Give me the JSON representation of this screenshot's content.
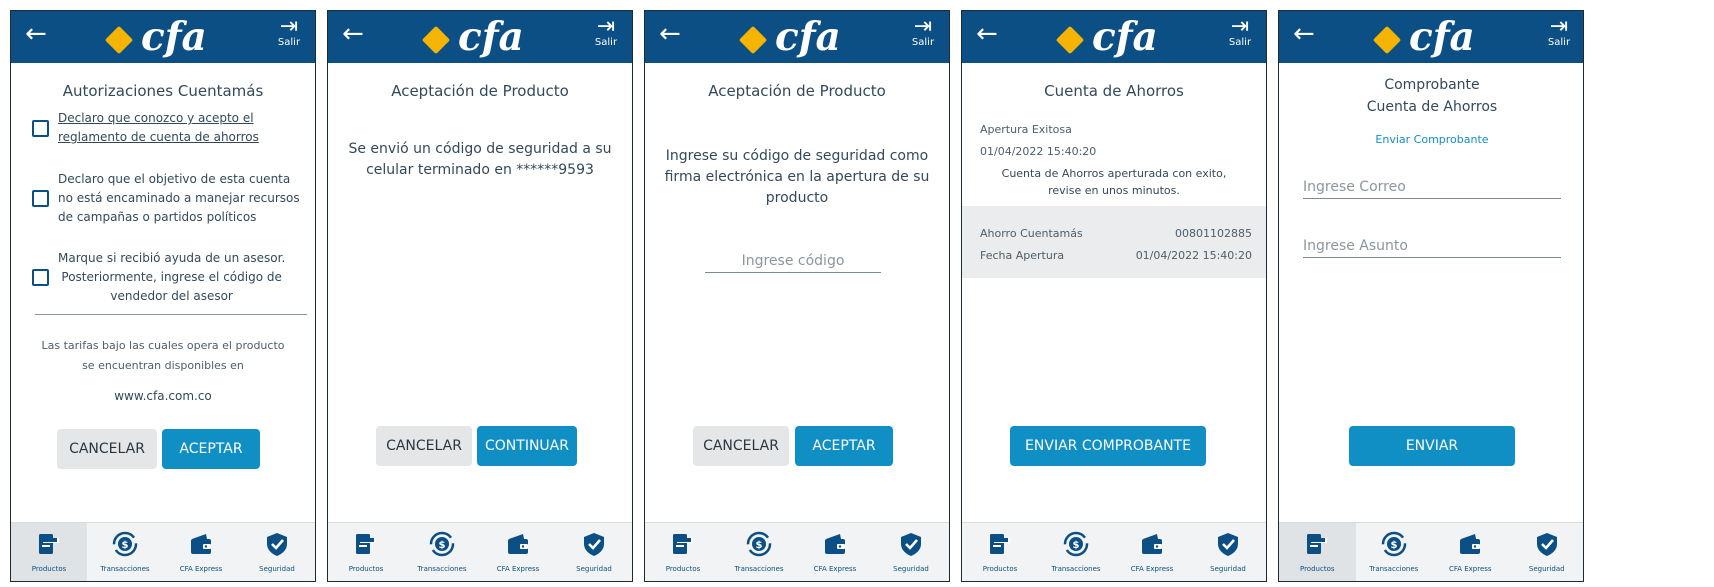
{
  "header": {
    "back_icon": "arrow-left-icon",
    "brand": "cfa",
    "logout_label": "Salir",
    "colors": {
      "header_bg": "#0b4f84",
      "logo_mark": "#f4b400",
      "accent": "#0f8fc4"
    }
  },
  "nav": [
    "Productos",
    "Transacciones",
    "CFA Express",
    "Seguridad"
  ],
  "screen1": {
    "title": "Autorizaciones Cuentamás",
    "checks": [
      [
        "Declaro que conozco y acepto el",
        "reglamento de cuenta de ahorros"
      ],
      [
        "Declaro que el objetivo de esta cuenta",
        "no está encaminado a manejar recursos",
        "de campañas o partidos políticos"
      ],
      [
        "Marque si recibió ayuda de un asesor.",
        "Posteriormente, ingrese el código de",
        "vendedor del asesor"
      ]
    ],
    "tarifas": [
      "Las tarifas bajo las cuales opera el producto",
      "se encuentran disponibles en"
    ],
    "url": "www.cfa.com.co",
    "cancel": "CANCELAR",
    "accept": "ACEPTAR"
  },
  "screen2": {
    "title": "Aceptación de Producto",
    "message": [
      "Se envió un código de seguridad a su",
      "celular terminado en ******9593"
    ],
    "cancel": "CANCELAR",
    "continue": "CONTINUAR"
  },
  "screen3": {
    "title": "Aceptación de Producto",
    "message": [
      "Ingrese su código de seguridad como",
      "firma electrónica en la apertura de su",
      "producto"
    ],
    "code_placeholder": "Ingrese código",
    "cancel": "CANCELAR",
    "accept": "ACEPTAR"
  },
  "screen4": {
    "title": "Cuenta de Ahorros",
    "status": "Apertura Exitosa",
    "datetime": "01/04/2022 15:40:20",
    "success": [
      "Cuenta de Ahorros aperturada con exito,",
      "revise en unos minutos."
    ],
    "account_label": "Ahorro Cuentamás",
    "account_number": "00801102885",
    "date_label": "Fecha Apertura",
    "date_value": "01/04/2022 15:40:20",
    "send_button": "ENVIAR COMPROBANTE"
  },
  "screen5": {
    "title1": "Comprobante",
    "title2": "Cuenta de Ahorros",
    "subtitle": "Enviar Comprobante",
    "email_placeholder": "Ingrese Correo",
    "subject_placeholder": "Ingrese Asunto",
    "send_button": "ENVIAR"
  }
}
